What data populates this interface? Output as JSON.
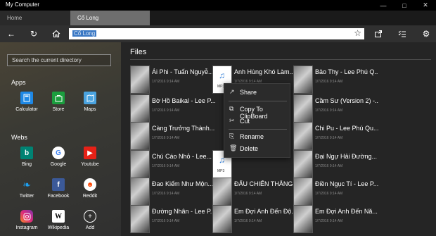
{
  "window": {
    "title": "My Computer"
  },
  "tabs": [
    {
      "label": "Home"
    },
    {
      "label": "Cổ Long"
    }
  ],
  "address": {
    "value": "Cổ Long"
  },
  "sidebar": {
    "search_placeholder": "Search the current directory",
    "apps_title": "Apps",
    "apps": [
      {
        "label": "Calculator"
      },
      {
        "label": "Store"
      },
      {
        "label": "Maps"
      }
    ],
    "webs_title": "Webs",
    "webs": [
      {
        "label": "Bing"
      },
      {
        "label": "Google"
      },
      {
        "label": "Youtube"
      },
      {
        "label": "Twitter"
      },
      {
        "label": "Facebook"
      },
      {
        "label": "Reddit"
      },
      {
        "label": "Instagram"
      },
      {
        "label": "Wikipedia"
      },
      {
        "label": "Add"
      }
    ]
  },
  "files": {
    "title": "Files",
    "items": [
      {
        "name": "Ái Phi - Tuấn Nguyễ...",
        "meta": "1/7/2016 9:14 AM"
      },
      {
        "name": "Anh Hùng Khó Làm...",
        "meta": "1/7/2016 9:14 AM"
      },
      {
        "name": "Bảo Thy - Lee Phú Q...",
        "meta": "1/7/2016 9:14 AM"
      },
      {
        "name": "Bờ Hồ Baikal - Lee P...",
        "meta": "1/7/2016 9:14 AM"
      },
      {
        "name": "Cầm Sư (Version 2) -...",
        "meta": "1/7/2016 9:14 AM"
      },
      {
        "name": "Càng Trưởng Thành...",
        "meta": "1/7/2016 9:14 AM"
      },
      {
        "name": "Chi Pu - Lee Phú Qu...",
        "meta": "1/7/2016 9:14 AM"
      },
      {
        "name": "Chú Cáo Nhỏ - Lee...",
        "meta": "1/7/2016 9:14 AM"
      },
      {
        "name": "Đại Ngự Hải Đường...",
        "meta": "1/7/2016 9:14 AM"
      },
      {
        "name": "Đao Kiếm Như Mộn...",
        "meta": "1/7/2016 9:14 AM"
      },
      {
        "name": "ĐẤU CHIẾN THẮNG...",
        "meta": "1/7/2016 9:14 AM"
      },
      {
        "name": "Điền Ngục Tí - Lee P...",
        "meta": "1/7/2016 9:14 AM"
      },
      {
        "name": "Đường Nhân - Lee P...",
        "meta": "1/7/2016 9:14 AM"
      },
      {
        "name": "Em Đợi Anh Đến Độ...",
        "meta": "1/7/2016 9:14 AM"
      },
      {
        "name": "Em Đợi Anh Đến Nă...",
        "meta": "1/7/2016 9:14 AM"
      }
    ]
  },
  "context_menu": {
    "share": "Share",
    "copy": "Copy To ClipBoard",
    "cut": "Cut",
    "rename": "Rename",
    "delete": "Delete"
  }
}
